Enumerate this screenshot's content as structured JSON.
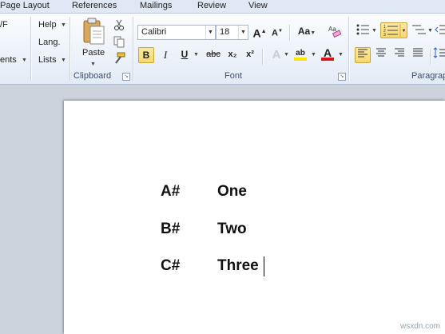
{
  "tabs": [
    "Page Layout",
    "References",
    "Mailings",
    "Review",
    "View"
  ],
  "left_fragments": {
    "vf": "/F",
    "help": "Help",
    "lang": "Lang.",
    "ents": "ents",
    "lists": "Lists"
  },
  "clipboard": {
    "paste_label": "Paste",
    "group_label": "Clipboard"
  },
  "font": {
    "family": "Calibri",
    "size": "18",
    "group_label": "Font",
    "bold": "B",
    "italic": "I",
    "underline": "U",
    "strike": "abc",
    "subscript": "x₂",
    "superscript": "x²",
    "grow": "A",
    "shrink": "A",
    "change_case": "Aa",
    "text_effects": "A",
    "highlight": "ab",
    "font_color": "A",
    "highlight_color": "#f5e600",
    "font_color_value": "#d01818"
  },
  "paragraph": {
    "group_label": "Paragrap"
  },
  "document": {
    "rows": [
      {
        "key": "A#",
        "value": "One"
      },
      {
        "key": "B#",
        "value": "Two"
      },
      {
        "key": "C#",
        "value": "Three"
      }
    ]
  },
  "watermark": "wsxdn.com"
}
